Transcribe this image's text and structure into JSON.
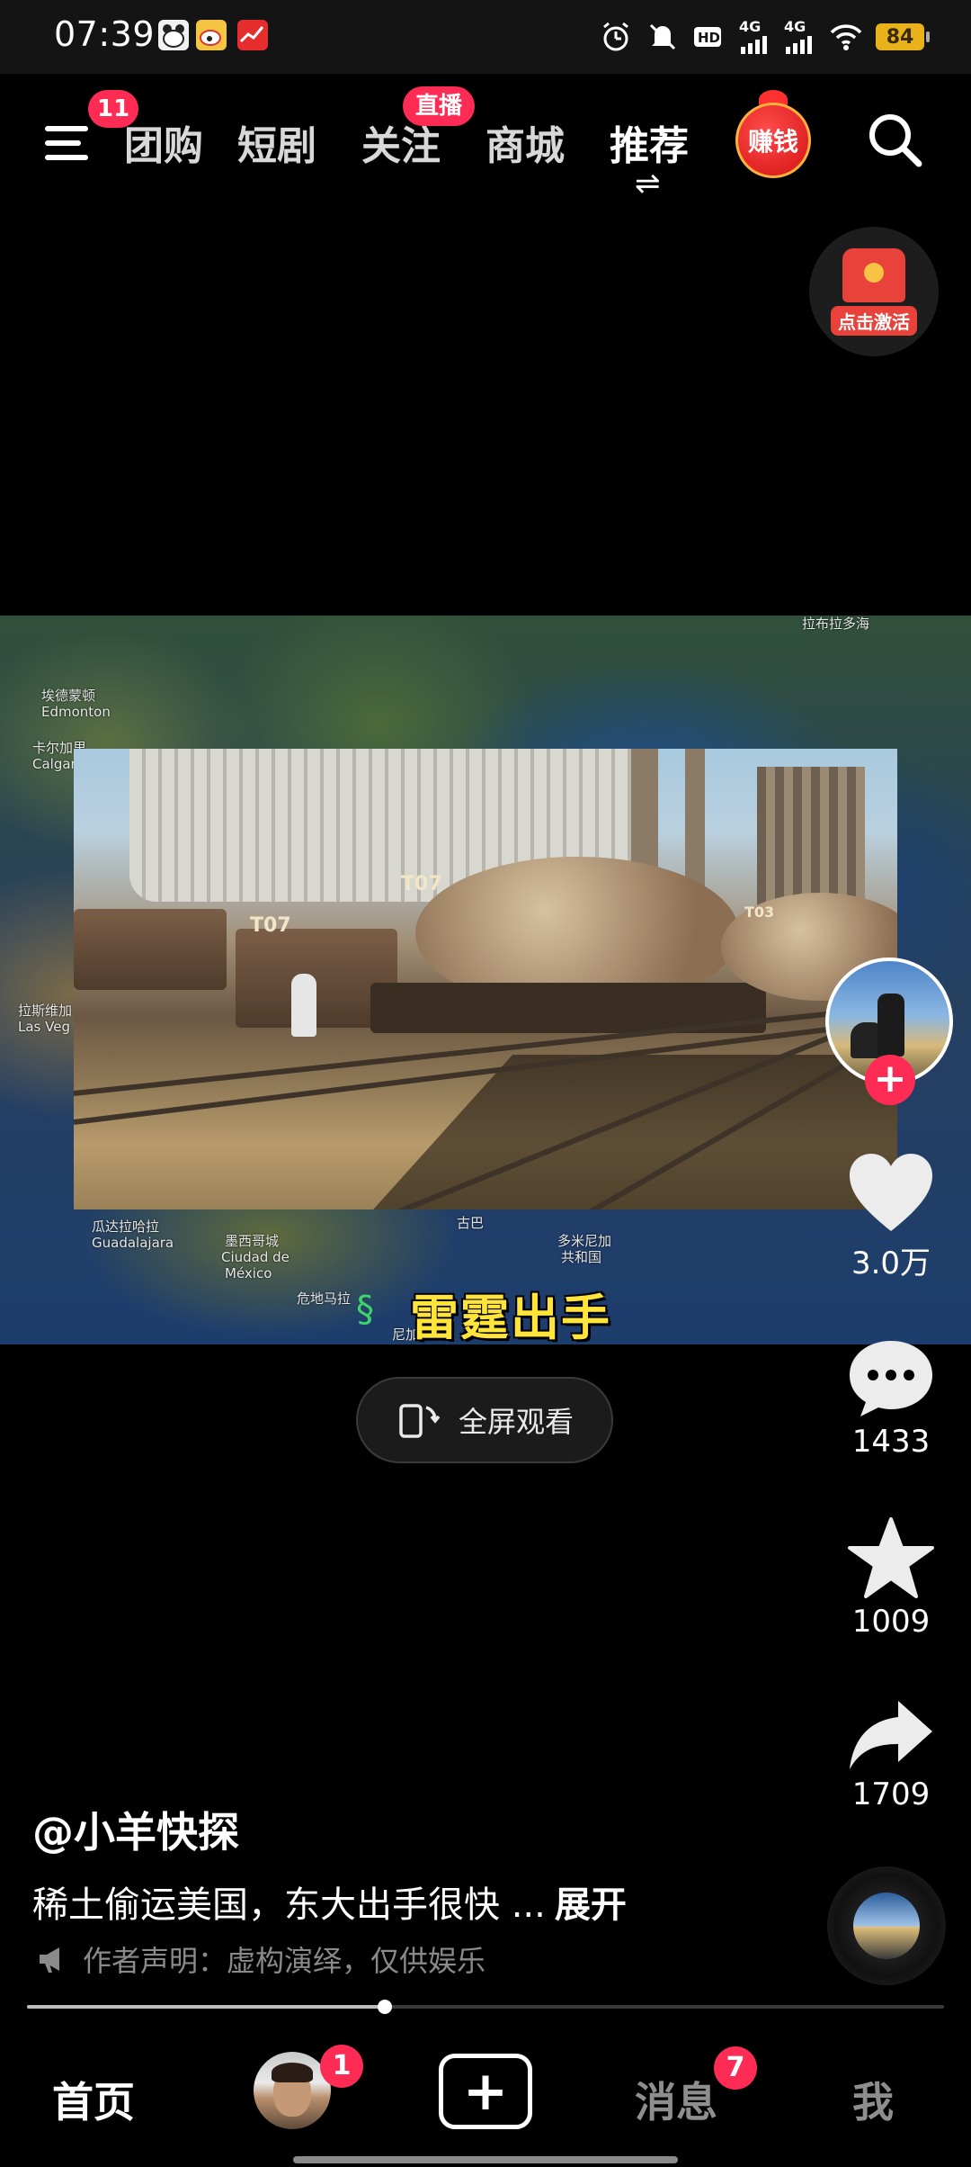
{
  "status_bar": {
    "time": "07:39",
    "battery": "84",
    "network_labels": [
      "4G",
      "4G"
    ],
    "icons": [
      "alarm-icon",
      "mute-icon",
      "hd-icon",
      "signal-icon",
      "signal-icon",
      "wifi-icon",
      "battery-icon"
    ],
    "app_icons": [
      "panda-app-icon",
      "weibo-app-icon",
      "stock-app-icon"
    ]
  },
  "top_nav": {
    "menu_badge": "11",
    "tabs": [
      {
        "label": "团购"
      },
      {
        "label": "短剧"
      },
      {
        "label": "关注"
      },
      {
        "label": "商城"
      },
      {
        "label": "推荐"
      }
    ],
    "live_badge": "直播",
    "switch_glyph": "⇌",
    "earn_label": "赚钱"
  },
  "activate_widget": {
    "label": "点击激活"
  },
  "video": {
    "caption": "雷霆出手",
    "map_labels": [
      "埃德蒙顿",
      "Edmonton",
      "卡尔加里",
      "Calgar",
      "拉斯维加",
      "Las Veg",
      "瓜达拉哈拉",
      "Guadalajara",
      "墨西哥城",
      "Ciudad de",
      "México",
      "古巴",
      "多米尼加",
      "共和国",
      "危地马拉",
      "尼加拉瓜",
      "拉布拉多海"
    ],
    "car_labels": [
      "T07",
      "T07",
      "T03"
    ]
  },
  "fullscreen_button": {
    "label": "全屏观看"
  },
  "actions": {
    "like_count": "3.0万",
    "comment_count": "1433",
    "favorite_count": "1009",
    "share_count": "1709"
  },
  "post": {
    "author": "@小羊快探",
    "description": "稀土偷运美国，东大出手很快 ...",
    "expand_label": "展开",
    "disclaimer": "作者声明：虚构演绎，仅供娱乐"
  },
  "progress": {
    "fraction": 0.39
  },
  "bottom_nav": {
    "home_label": "首页",
    "friends_badge": "1",
    "messages_label": "消息",
    "messages_badge": "7",
    "me_label": "我"
  },
  "colors": {
    "accent_red": "#fe2c55",
    "caption_yellow": "#ffe53b",
    "battery": "#e9b21a"
  }
}
